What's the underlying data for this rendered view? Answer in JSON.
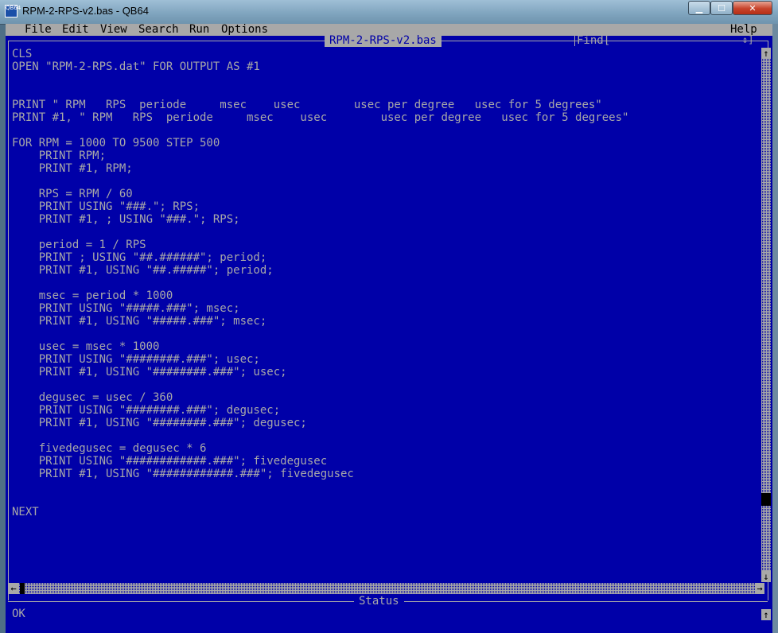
{
  "window": {
    "title": "RPM-2-RPS-v2.bas - QB64",
    "icon_label": "QB64",
    "buttons": {
      "minimize": "▁",
      "maximize": "☐",
      "close": "✕"
    }
  },
  "menu": [
    "File",
    "Edit",
    "View",
    "Search",
    "Run",
    "Options",
    "Help"
  ],
  "editor": {
    "file_tab": "RPM-2-RPS-v2.bas",
    "find_label": "Find[",
    "find_arrows": "⇕]",
    "lines": [
      "CLS",
      "OPEN \"RPM-2-RPS.dat\" FOR OUTPUT AS #1",
      "",
      "",
      "PRINT \" RPM   RPS  periode     msec    usec        usec per degree   usec for 5 degrees\"",
      "PRINT #1, \" RPM   RPS  periode     msec    usec        usec per degree   usec for 5 degrees\"",
      "",
      "FOR RPM = 1000 TO 9500 STEP 500",
      "    PRINT RPM;",
      "    PRINT #1, RPM;",
      "",
      "    RPS = RPM / 60",
      "    PRINT USING \"###.\"; RPS;",
      "    PRINT #1, ; USING \"###.\"; RPS;",
      "",
      "    period = 1 / RPS",
      "    PRINT ; USING \"##.######\"; period;",
      "    PRINT #1, USING \"##.#####\"; period;",
      "",
      "    msec = period * 1000",
      "    PRINT USING \"#####.###\"; msec;",
      "    PRINT #1, USING \"#####.###\"; msec;",
      "",
      "    usec = msec * 1000",
      "    PRINT USING \"########.###\"; usec;",
      "    PRINT #1, USING \"########.###\"; usec;",
      "",
      "    degusec = usec / 360",
      "    PRINT USING \"########.###\"; degusec;",
      "    PRINT #1, USING \"########.###\"; degusec;",
      "",
      "    fivedegusec = degusec * 6",
      "    PRINT USING \"############.###\"; fivedegusec",
      "    PRINT #1, USING \"############.###\"; fivedegusec",
      "",
      "",
      "NEXT"
    ]
  },
  "status": {
    "title": "Status",
    "text": "OK"
  },
  "colors": {
    "background": "#0000a8",
    "text": "#a8a8a8",
    "menubar": "#a8a8a8"
  }
}
